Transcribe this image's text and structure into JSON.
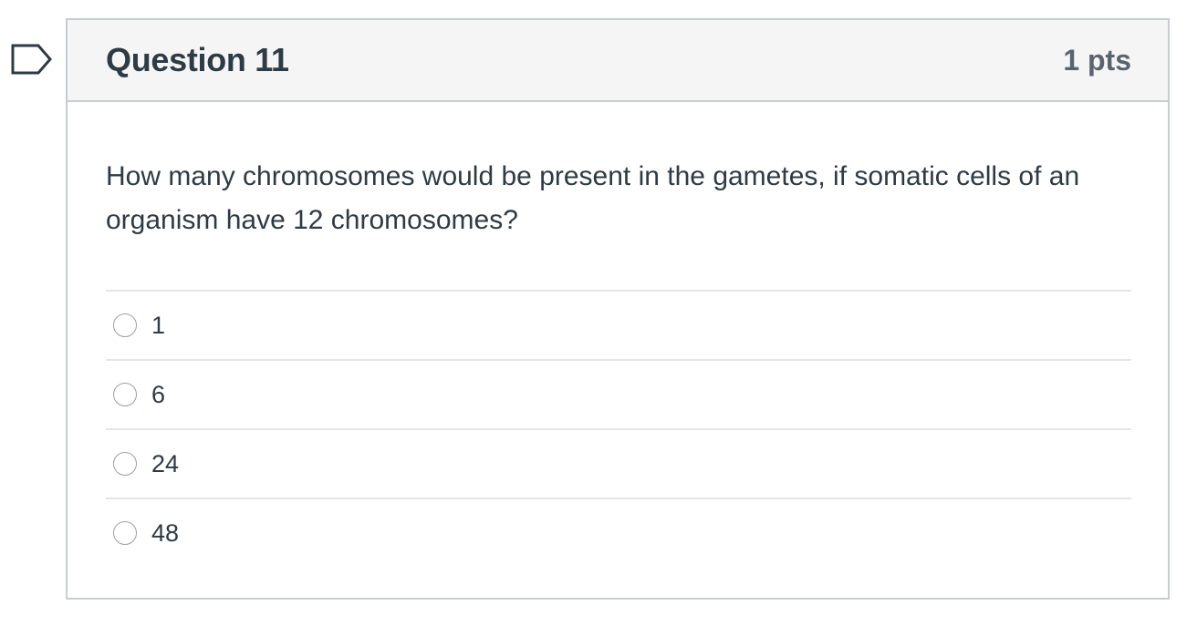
{
  "question": {
    "title": "Question 11",
    "points": "1 pts",
    "text": "How many chromosomes would be present in the gametes, if somatic cells of an organism have 12 chromosomes?",
    "flagged": false
  },
  "answers": [
    {
      "label": "1",
      "selected": false
    },
    {
      "label": "6",
      "selected": false
    },
    {
      "label": "24",
      "selected": false
    },
    {
      "label": "48",
      "selected": false
    }
  ]
}
